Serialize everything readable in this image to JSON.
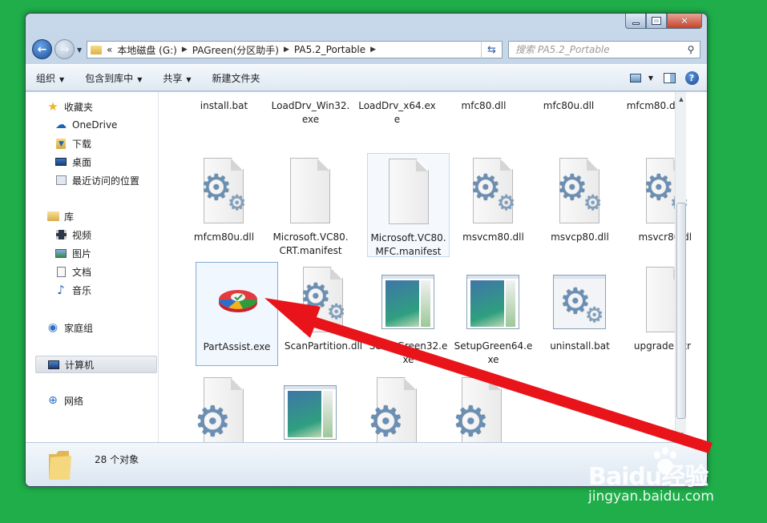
{
  "window": {
    "controls": {
      "minimize": "minimize",
      "maximize": "maximize",
      "close": "close"
    }
  },
  "address": {
    "chevrons": "«",
    "crumbs": [
      "本地磁盘 (G:)",
      "PAGreen(分区助手)",
      "PA5.2_Portable"
    ]
  },
  "search": {
    "placeholder": "搜索 PA5.2_Portable"
  },
  "toolbar": {
    "organize": "组织",
    "include_in_library": "包含到库中",
    "share": "共享",
    "new_folder": "新建文件夹"
  },
  "sidebar": {
    "favorites": "收藏夹",
    "onedrive": "OneDrive",
    "downloads": "下载",
    "desktop": "桌面",
    "recent": "最近访问的位置",
    "libraries": "库",
    "videos": "视频",
    "pictures": "图片",
    "documents": "文档",
    "music": "音乐",
    "homegroup": "家庭组",
    "computer": "计算机",
    "network": "网络"
  },
  "files": {
    "row1": [
      "install.bat",
      "LoadDrv_Win32.\nexe",
      "LoadDrv_x64.ex\ne",
      "mfc80.dll",
      "mfc80u.dll",
      "mfcm80.dll"
    ],
    "row2": [
      "mfcm80u.dll",
      "Microsoft.VC80.\nCRT.manifest",
      "Microsoft.VC80.\nMFC.manifest",
      "msvcm80.dll",
      "msvcp80.dll",
      "msvcr80.dll"
    ],
    "row3": [
      "PartAssist.exe",
      "ScanPartition.dll",
      "SetupGreen32.e\nxe",
      "SetupGreen64.e\nxe",
      "uninstall.bat",
      "upgrade.html"
    ]
  },
  "details": {
    "count": "28 个对象"
  },
  "watermark": {
    "logo": "Baidu经验",
    "url": "jingyan.baidu.com"
  },
  "colors": {
    "background": "#1fae4a",
    "selection": "#84acd5",
    "arrow": "#e8141a"
  }
}
